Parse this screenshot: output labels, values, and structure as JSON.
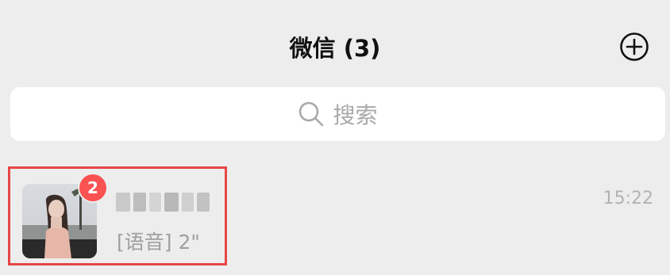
{
  "header": {
    "title": "微信 (3)",
    "add_icon": "plus-circle-icon"
  },
  "search": {
    "placeholder": "搜索",
    "icon": "search-icon"
  },
  "chats": [
    {
      "name": "",
      "name_blurred": true,
      "preview": "[语音] 2\"",
      "time": "15:22",
      "unread": "2",
      "avatar": "profile-photo"
    }
  ],
  "colors": {
    "background": "#ededed",
    "badge": "#fa5151",
    "highlight_border": "#e64545"
  }
}
